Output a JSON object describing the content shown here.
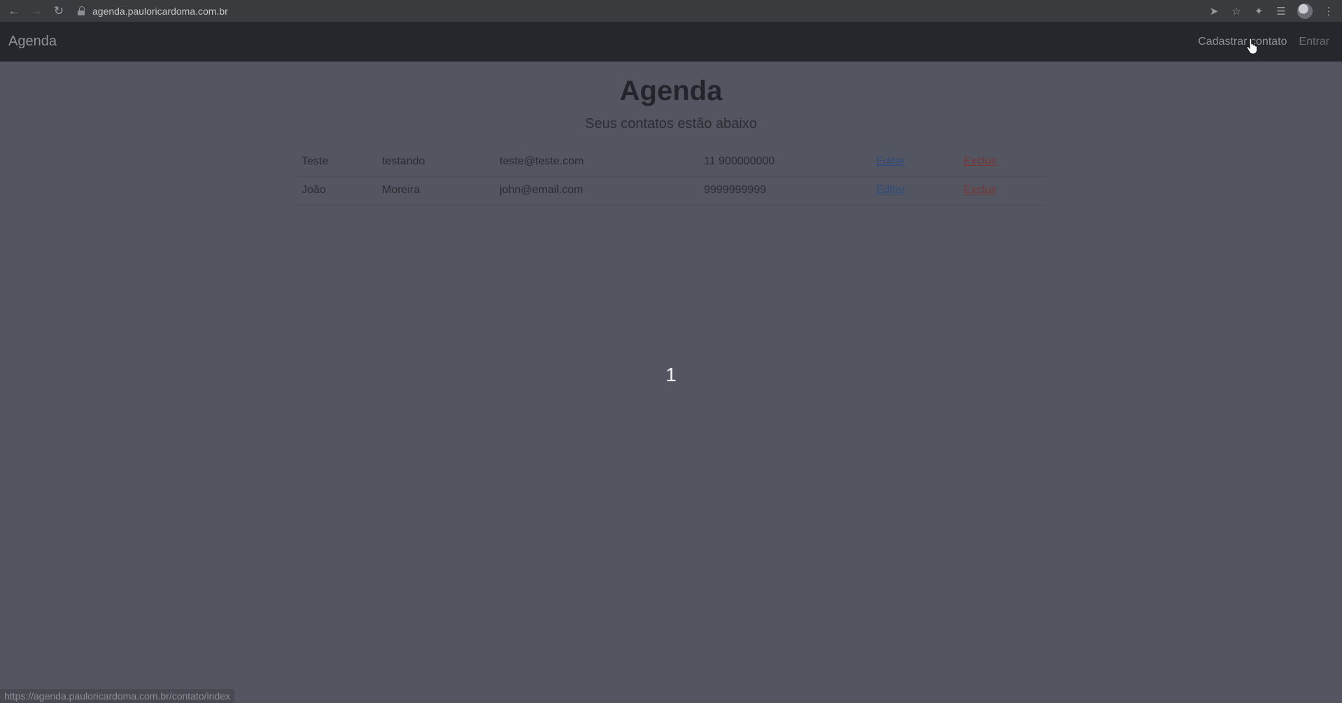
{
  "browser": {
    "url": "agenda.pauloricardoma.com.br",
    "back_icon": "arrow-left-icon",
    "forward_icon": "arrow-right-icon",
    "reload_icon": "reload-icon",
    "status_url": "https://agenda.pauloricardoma.com.br/contato/index"
  },
  "navbar": {
    "brand": "Agenda",
    "links": {
      "register_contact": "Cadastrar contato",
      "login": "Entrar"
    }
  },
  "main": {
    "title": "Agenda",
    "subtitle": "Seus contatos estão abaixo",
    "contacts": [
      {
        "name": "Teste",
        "surname": "testando",
        "email": "teste@teste.com",
        "phone": "11 900000000",
        "edit_label": "Editar",
        "delete_label": "Excluir"
      },
      {
        "name": "João",
        "surname": "Moreira",
        "email": "john@email.com",
        "phone": "9999999999",
        "edit_label": "Editar",
        "delete_label": "Excluir"
      }
    ],
    "pagination": "1"
  },
  "colors": {
    "page_background": "#535661",
    "navbar_background": "#25272c",
    "edit_link": "#2f4a7a",
    "delete_link": "#7a3636"
  }
}
